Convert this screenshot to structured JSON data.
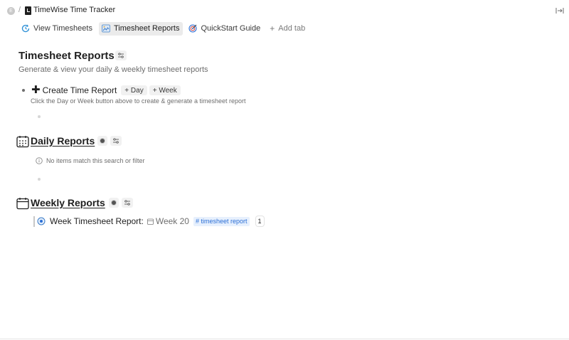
{
  "topbar": {
    "avatar_letter": "E",
    "separator": "/",
    "app_title": "TimeWise Time Tracker"
  },
  "tabs": [
    {
      "label": "View Timesheets",
      "icon": "clock-refresh-icon",
      "active": false
    },
    {
      "label": "Timesheet Reports",
      "icon": "image-report-icon",
      "active": true
    },
    {
      "label": "QuickStart Guide",
      "icon": "target-icon",
      "active": false
    },
    {
      "label": "Add tab",
      "icon": "plus-icon",
      "active": false
    }
  ],
  "add_tab_plus": "+",
  "page": {
    "title": "Timesheet Reports",
    "subtitle": "Generate & view your daily & weekly timesheet reports"
  },
  "create": {
    "plus": "✚",
    "label": "Create Time Report",
    "day_chip": "+ Day",
    "week_chip": "+ Week",
    "hint": "Click the Day or Week button above to create & generate a timesheet report"
  },
  "daily": {
    "title": "Daily Reports",
    "icon": "calendar-grid-icon",
    "empty_text": "No items match this search or filter"
  },
  "weekly": {
    "title": "Weekly Reports",
    "icon": "calendar-icon",
    "rows": [
      {
        "label": "Week Timesheet Report:",
        "week": "Week 20",
        "tag": "# timesheet report",
        "count": "1"
      }
    ]
  },
  "colors": {
    "accent_blue": "#2b6fd6",
    "tag_bg": "#e7f0fd",
    "active_tab_bg": "#ebebeb",
    "text_muted": "#6e6e6e"
  }
}
